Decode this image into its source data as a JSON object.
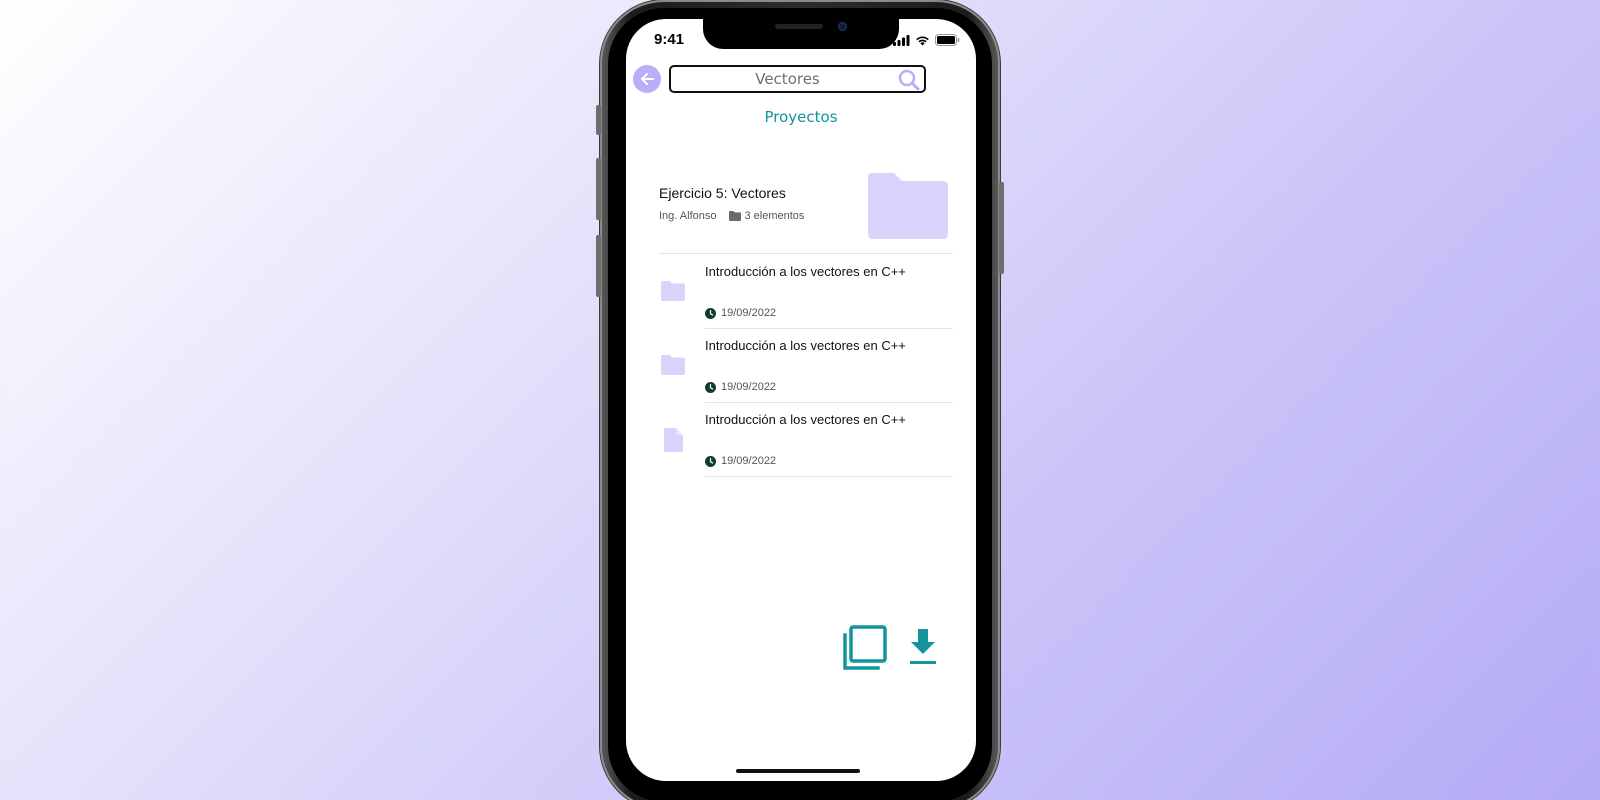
{
  "status_bar": {
    "time": "9:41"
  },
  "header": {
    "search_value": "Vectores",
    "section_title": "Proyectos"
  },
  "project": {
    "title": "Ejercicio 5: Vectores",
    "author": "Ing. Alfonso",
    "count": "3 elementos"
  },
  "items": [
    {
      "icon": "folder-icon",
      "title": "Introducción a los vectores en C++",
      "date": "19/09/2022"
    },
    {
      "icon": "folder-icon",
      "title": "Introducción a los vectores en C++",
      "date": "19/09/2022"
    },
    {
      "icon": "file-icon",
      "title": "Introducción a los vectores en C++",
      "date": "19/09/2022"
    }
  ],
  "colors": {
    "accent": "#12959c",
    "lavender": "#b9aef7",
    "folder_fill": "#d9d3fb"
  },
  "actions": {
    "copy_icon": "copy-icon",
    "download_icon": "download-icon"
  }
}
